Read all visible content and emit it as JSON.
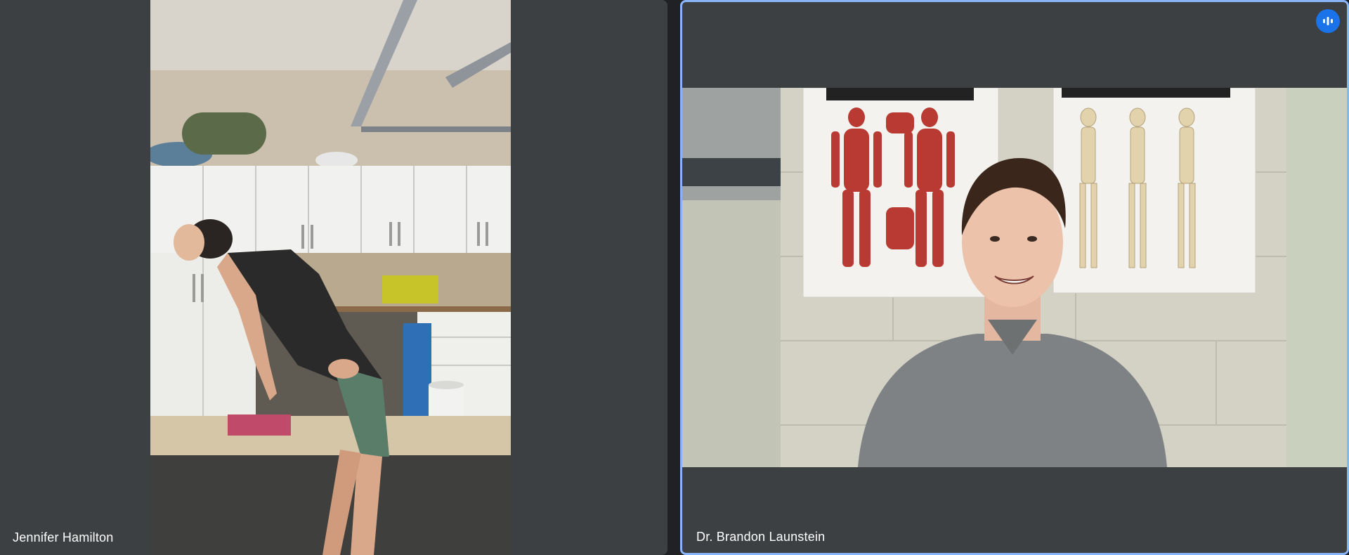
{
  "participants": [
    {
      "name": "Jennifer Hamilton",
      "speaking": false
    },
    {
      "name": "Dr. Brandon Launstein",
      "speaking": true,
      "active_speaker_color": "#8ab4f8"
    }
  ],
  "icons": {
    "speaking": "audio-level-icon"
  },
  "colors": {
    "tile_background": "#3c4043",
    "page_background": "#202124",
    "accent": "#1a73e8"
  }
}
